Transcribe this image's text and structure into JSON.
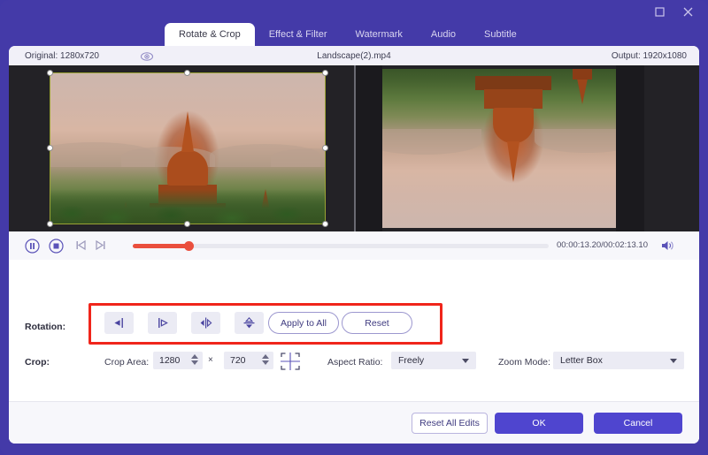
{
  "window": {
    "controls": [
      {
        "name": "maximize-button",
        "icon": "maximize-icon"
      },
      {
        "name": "close-button",
        "icon": "close-icon"
      }
    ]
  },
  "tabs": [
    {
      "label": "Rotate & Crop",
      "active": true
    },
    {
      "label": "Effect & Filter",
      "active": false
    },
    {
      "label": "Watermark",
      "active": false
    },
    {
      "label": "Audio",
      "active": false
    },
    {
      "label": "Subtitle",
      "active": false
    }
  ],
  "info_bar": {
    "original_label": "Original: 1280x720",
    "preview_toggle_icon": "eye-icon",
    "file_name": "Landscape(2).mp4",
    "output_label": "Output: 1920x1080"
  },
  "preview": {
    "left_caption": "original-preview",
    "right_caption": "output-preview",
    "crop_handles": 8
  },
  "playback": {
    "pause_icon": "pause-icon",
    "stop_icon": "stop-icon",
    "prev_frame_icon": "previous-frame-icon",
    "next_frame_icon": "next-frame-icon",
    "timecode": "00:00:13.20/00:02:13.10",
    "volume_icon": "volume-icon",
    "progress_percent": 10
  },
  "rotation": {
    "label": "Rotation:",
    "buttons": [
      {
        "name": "rotate-left-button",
        "icon": "rotate-left-icon"
      },
      {
        "name": "rotate-right-button",
        "icon": "rotate-right-icon"
      },
      {
        "name": "flip-horizontal-button",
        "icon": "flip-horizontal-icon"
      },
      {
        "name": "flip-vertical-button",
        "icon": "flip-vertical-icon"
      }
    ],
    "apply_to_all_label": "Apply to All",
    "reset_label": "Reset"
  },
  "crop": {
    "label": "Crop:",
    "crop_area_label": "Crop Area:",
    "width": "1280",
    "separator": "×",
    "height": "720",
    "position_icon": "crop-position-icon",
    "aspect_ratio_label": "Aspect Ratio:",
    "aspect_ratio_value": "Freely",
    "zoom_mode_label": "Zoom Mode:",
    "zoom_mode_value": "Letter Box"
  },
  "footer": {
    "reset_all_label": "Reset All Edits",
    "ok_label": "OK",
    "cancel_label": "Cancel"
  },
  "colors": {
    "brand_purple": "#443aa8",
    "accent_button": "#4f45cf",
    "annotation_red": "#f0251b",
    "slider_red": "#ea4f3d"
  }
}
